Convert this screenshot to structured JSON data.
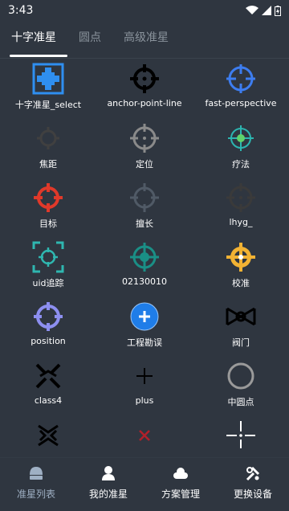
{
  "status_bar": {
    "time": "3:43"
  },
  "tabs": [
    {
      "label": "十字准星",
      "active": true
    },
    {
      "label": "圆点",
      "active": false
    },
    {
      "label": "高级准星",
      "active": false
    }
  ],
  "items": [
    {
      "label": "十字准星_select",
      "icon": "square-crosshair-icon",
      "color": "#2f8ff0"
    },
    {
      "label": "anchor-point-line",
      "icon": "anchor-crosshair-icon",
      "color": "#000000"
    },
    {
      "label": "fast-perspective",
      "icon": "perspective-crosshair-icon",
      "color": "#3d7df0"
    },
    {
      "label": "焦距",
      "icon": "focus-crosshair-icon",
      "color": "#404040"
    },
    {
      "label": "定位",
      "icon": "locate-crosshair-icon",
      "color": "#8a8a8a"
    },
    {
      "label": "疗法",
      "icon": "therapy-crosshair-icon",
      "color": "#2cb5b0"
    },
    {
      "label": "目标",
      "icon": "target-crosshair-icon",
      "color": "#e0392a"
    },
    {
      "label": "擅长",
      "icon": "skill-crosshair-icon",
      "color": "#505a66"
    },
    {
      "label": "lhyg_",
      "icon": "lhyg-crosshair-icon",
      "color": "#3a3a3a"
    },
    {
      "label": "uid追踪",
      "icon": "uid-tracking-crosshair-icon",
      "color": "#2fb7b0"
    },
    {
      "label": "02130010",
      "icon": "number-crosshair-icon",
      "color": "#1a8f86"
    },
    {
      "label": "校准",
      "icon": "calibrate-crosshair-icon",
      "color": "#f2b233"
    },
    {
      "label": "position",
      "icon": "position-crosshair-icon",
      "color": "#8d8ff0"
    },
    {
      "label": "工程勘误",
      "icon": "engineering-crosshair-icon",
      "color": "#1f7de8"
    },
    {
      "label": "阀门",
      "icon": "valve-crosshair-icon",
      "color": "#000000"
    },
    {
      "label": "class4",
      "icon": "x-chevron-crosshair-icon",
      "color": "#000000"
    },
    {
      "label": "plus",
      "icon": "plus-crosshair-icon",
      "color": "#000000"
    },
    {
      "label": "中圆点",
      "icon": "circle-crosshair-icon",
      "color": "#9a9a9a"
    },
    {
      "label": "",
      "icon": "chevron-x-crosshair-icon",
      "color": "#000000"
    },
    {
      "label": "",
      "icon": "small-x-crosshair-icon",
      "color": "#b0202a"
    },
    {
      "label": "",
      "icon": "gap-cross-crosshair-icon",
      "color": "#ffffff"
    }
  ],
  "bottom_nav": [
    {
      "label": "准星列表",
      "icon": "crosshair-list-icon",
      "active": true
    },
    {
      "label": "我的准星",
      "icon": "user-icon",
      "active": false
    },
    {
      "label": "方案管理",
      "icon": "cloud-icon",
      "active": false
    },
    {
      "label": "更换设备",
      "icon": "wrench-icon",
      "active": false
    }
  ],
  "colors": {
    "background": "#2f3640",
    "active_nav": "#9fb0c4"
  }
}
